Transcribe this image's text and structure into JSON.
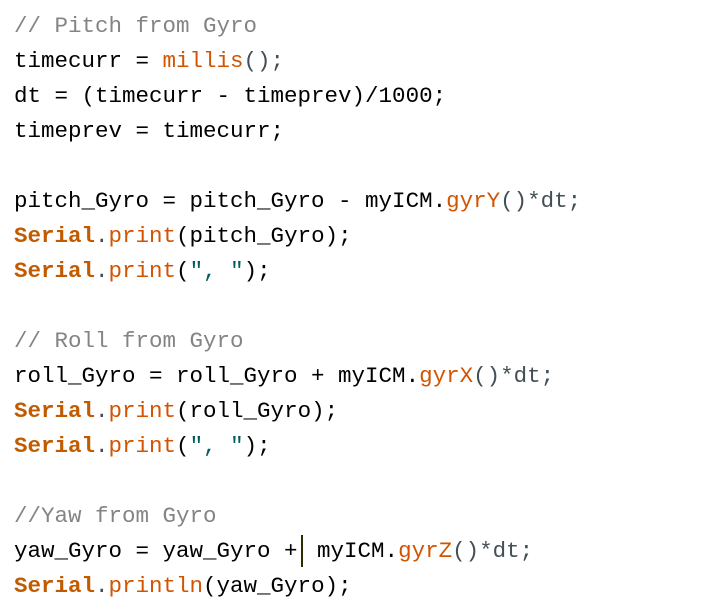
{
  "editor": {
    "lines": [
      [
        {
          "t": "// Pitch from Gyro",
          "c": "comment"
        }
      ],
      [
        {
          "t": "timecurr = ",
          "c": "text"
        },
        {
          "t": "millis",
          "c": "func"
        },
        {
          "t": "();",
          "c": "punct"
        }
      ],
      [
        {
          "t": "dt = (timecurr - timeprev)/1000;",
          "c": "text"
        }
      ],
      [
        {
          "t": "timeprev = timecurr;",
          "c": "text"
        }
      ],
      [],
      [
        {
          "t": "pitch_Gyro = pitch_Gyro - myICM.",
          "c": "text"
        },
        {
          "t": "gyrY",
          "c": "func"
        },
        {
          "t": "()*dt;",
          "c": "punct"
        }
      ],
      [
        {
          "t": "Serial",
          "c": "obj"
        },
        {
          "t": ".",
          "c": "punct"
        },
        {
          "t": "print",
          "c": "func"
        },
        {
          "t": "(pitch_Gyro);",
          "c": "text"
        }
      ],
      [
        {
          "t": "Serial",
          "c": "obj"
        },
        {
          "t": ".",
          "c": "punct"
        },
        {
          "t": "print",
          "c": "func"
        },
        {
          "t": "(",
          "c": "text"
        },
        {
          "t": "\", \"",
          "c": "str"
        },
        {
          "t": ");",
          "c": "text"
        }
      ],
      [],
      [
        {
          "t": "// Roll from Gyro",
          "c": "comment"
        }
      ],
      [
        {
          "t": "roll_Gyro = roll_Gyro + myICM.",
          "c": "text"
        },
        {
          "t": "gyrX",
          "c": "func"
        },
        {
          "t": "()*dt;",
          "c": "punct"
        }
      ],
      [
        {
          "t": "Serial",
          "c": "obj"
        },
        {
          "t": ".",
          "c": "punct"
        },
        {
          "t": "print",
          "c": "func"
        },
        {
          "t": "(roll_Gyro);",
          "c": "text"
        }
      ],
      [
        {
          "t": "Serial",
          "c": "obj"
        },
        {
          "t": ".",
          "c": "punct"
        },
        {
          "t": "print",
          "c": "func"
        },
        {
          "t": "(",
          "c": "text"
        },
        {
          "t": "\", \"",
          "c": "str"
        },
        {
          "t": ");",
          "c": "text"
        }
      ],
      [],
      [
        {
          "t": "//Yaw from Gyro",
          "c": "comment"
        }
      ],
      [
        {
          "t": "yaw_Gyro = yaw_Gyro +",
          "c": "text"
        },
        {
          "t": "",
          "c": "cursor"
        },
        {
          "t": " myICM.",
          "c": "text"
        },
        {
          "t": "gyrZ",
          "c": "func"
        },
        {
          "t": "()*dt;",
          "c": "punct"
        }
      ],
      [
        {
          "t": "Serial",
          "c": "obj"
        },
        {
          "t": ".",
          "c": "punct"
        },
        {
          "t": "println",
          "c": "func"
        },
        {
          "t": "(yaw_Gyro);",
          "c": "text"
        }
      ]
    ]
  }
}
